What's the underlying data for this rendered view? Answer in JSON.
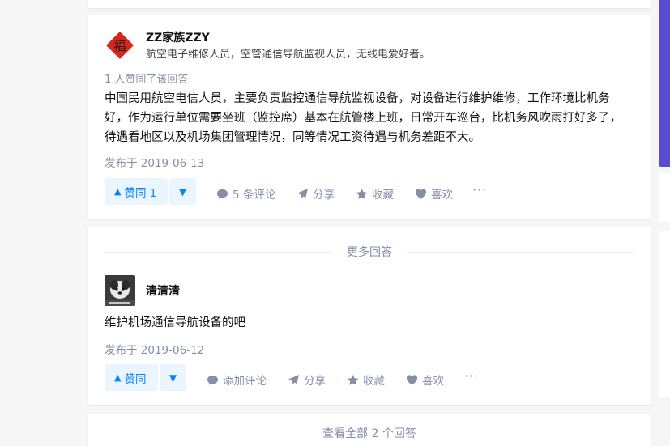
{
  "answer1": {
    "author_name": "ZZ家族ZZY",
    "author_bio": "航空电子维修人员，空管通信导航监视人员，无线电爱好者。",
    "avatar_glyph": "福",
    "avatar_color": "#d7261b",
    "upvote_meta": "1 人赞同了该回答",
    "content": "中国民用航空电信人员，主要负责监控通信导航监视设备，对设备进行维护维修，工作环境比机务好，作为运行单位需要坐班（监控席）基本在航管楼上班，日常开车巡台，比机务风吹雨打好多了，待遇看地区以及机场集团管理情况，同等情况工资待遇与机务差距不大。",
    "date": "发布于 2019-06-13",
    "vote_up_label": "赞同 1",
    "comments_label": "5 条评论",
    "share_label": "分享",
    "collect_label": "收藏",
    "like_label": "喜欢",
    "more_label": "···"
  },
  "more_answers_label": "更多回答",
  "answer2": {
    "author_name": "清清清",
    "content": "维护机场通信导航设备的吧",
    "date": "发布于 2019-06-12",
    "vote_up_label": "赞同",
    "comments_label": "添加评论",
    "share_label": "分享",
    "collect_label": "收藏",
    "like_label": "喜欢",
    "more_label": "···"
  },
  "view_all_label": "查看全部 2 个回答",
  "colors": {
    "accent": "#0084ff",
    "accent_bg": "#ebf5ff",
    "muted": "#8590a6",
    "scroll_accent": "#5a4ccf"
  }
}
